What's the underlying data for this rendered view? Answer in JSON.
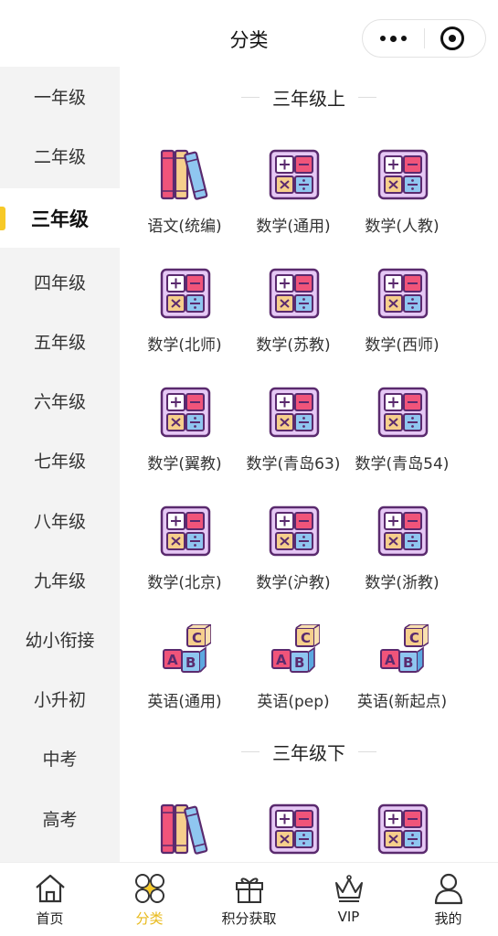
{
  "header": {
    "title": "分类"
  },
  "sidebar": {
    "items": [
      {
        "label": "一年级"
      },
      {
        "label": "二年级"
      },
      {
        "label": "三年级",
        "active": true
      },
      {
        "label": "四年级"
      },
      {
        "label": "五年级"
      },
      {
        "label": "六年级"
      },
      {
        "label": "七年级"
      },
      {
        "label": "八年级"
      },
      {
        "label": "九年级"
      },
      {
        "label": "幼小衔接"
      },
      {
        "label": "小升初"
      },
      {
        "label": "中考"
      },
      {
        "label": "高考"
      }
    ]
  },
  "main": {
    "sections": [
      {
        "title": "三年级上",
        "items": [
          {
            "label": "语文(统编)",
            "icon": "books-icon"
          },
          {
            "label": "数学(通用)",
            "icon": "calculator-icon"
          },
          {
            "label": "数学(人教)",
            "icon": "calculator-icon"
          },
          {
            "label": "数学(北师)",
            "icon": "calculator-icon"
          },
          {
            "label": "数学(苏教)",
            "icon": "calculator-icon"
          },
          {
            "label": "数学(西师)",
            "icon": "calculator-icon"
          },
          {
            "label": "数学(翼教)",
            "icon": "calculator-icon"
          },
          {
            "label": "数学(青岛63)",
            "icon": "calculator-icon"
          },
          {
            "label": "数学(青岛54)",
            "icon": "calculator-icon"
          },
          {
            "label": "数学(北京)",
            "icon": "calculator-icon"
          },
          {
            "label": "数学(沪教)",
            "icon": "calculator-icon"
          },
          {
            "label": "数学(浙教)",
            "icon": "calculator-icon"
          },
          {
            "label": "英语(通用)",
            "icon": "abc-blocks-icon"
          },
          {
            "label": "英语(pep)",
            "icon": "abc-blocks-icon"
          },
          {
            "label": "英语(新起点)",
            "icon": "abc-blocks-icon"
          }
        ]
      },
      {
        "title": "三年级下",
        "items": [
          {
            "label": "",
            "icon": "books-icon"
          },
          {
            "label": "",
            "icon": "calculator-icon"
          },
          {
            "label": "",
            "icon": "calculator-icon"
          }
        ]
      }
    ]
  },
  "tabbar": {
    "items": [
      {
        "label": "首页",
        "icon": "home-icon"
      },
      {
        "label": "分类",
        "icon": "category-icon",
        "active": true
      },
      {
        "label": "积分获取",
        "icon": "gift-icon"
      },
      {
        "label": "VIP",
        "icon": "crown-icon"
      },
      {
        "label": "我的",
        "icon": "user-icon"
      }
    ]
  },
  "colors": {
    "accent": "#f7c927",
    "active_tab": "#e8b919",
    "sidebar_bg": "#f3f3f3",
    "calc_bg": "#e6c8f5",
    "calc_border": "#5a2a6e"
  }
}
